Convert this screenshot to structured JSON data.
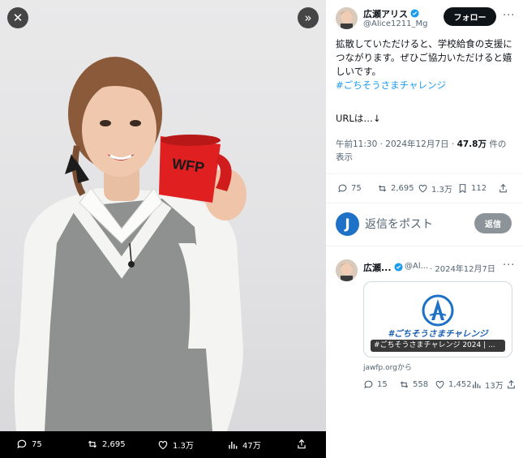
{
  "media": {
    "close_icon": "close-icon",
    "expand_icon": "expand-icon",
    "mug_text": "WFP",
    "bar": {
      "replies": "75",
      "retweets": "2,695",
      "likes": "1.3万",
      "views": "47万"
    }
  },
  "tweet": {
    "name": "広瀬アリス",
    "handle": "@Alice1211_Mg",
    "follow_label": "フォロー",
    "more": "···",
    "text": "拡散していただけると、学校給食の支援につながります。ぜひご協力いただけると嬉しいです。",
    "hashtag": "#ごちそうさまチャレンジ",
    "url_text": "URLは…↓",
    "time": "午前11:30 · 2024年12月7日 · ",
    "views_count": "47.8万",
    "views_label": " 件の表示",
    "actions": {
      "replies": "75",
      "retweets": "2,695",
      "likes": "1.3万",
      "bookmarks": "112"
    }
  },
  "reply_box": {
    "avatar_letter": "J",
    "placeholder": "返信をポスト",
    "button": "返信"
  },
  "reply_tweet": {
    "name": "広瀬...",
    "handle": "@Al...",
    "date": "· 2024年12月7日",
    "more": "···",
    "card_hashtag": "#ごちそうさまチャレンジ",
    "card_caption": "#ごちそうさまチャレンジ 2024 | ...",
    "card_domain": "jawfp.orgから",
    "actions": {
      "replies": "15",
      "retweets": "558",
      "likes": "1,452",
      "views": "13万"
    }
  },
  "colors": {
    "accent": "#1d9bf0",
    "mug": "#e02020",
    "follow_bg": "#0f1419"
  }
}
